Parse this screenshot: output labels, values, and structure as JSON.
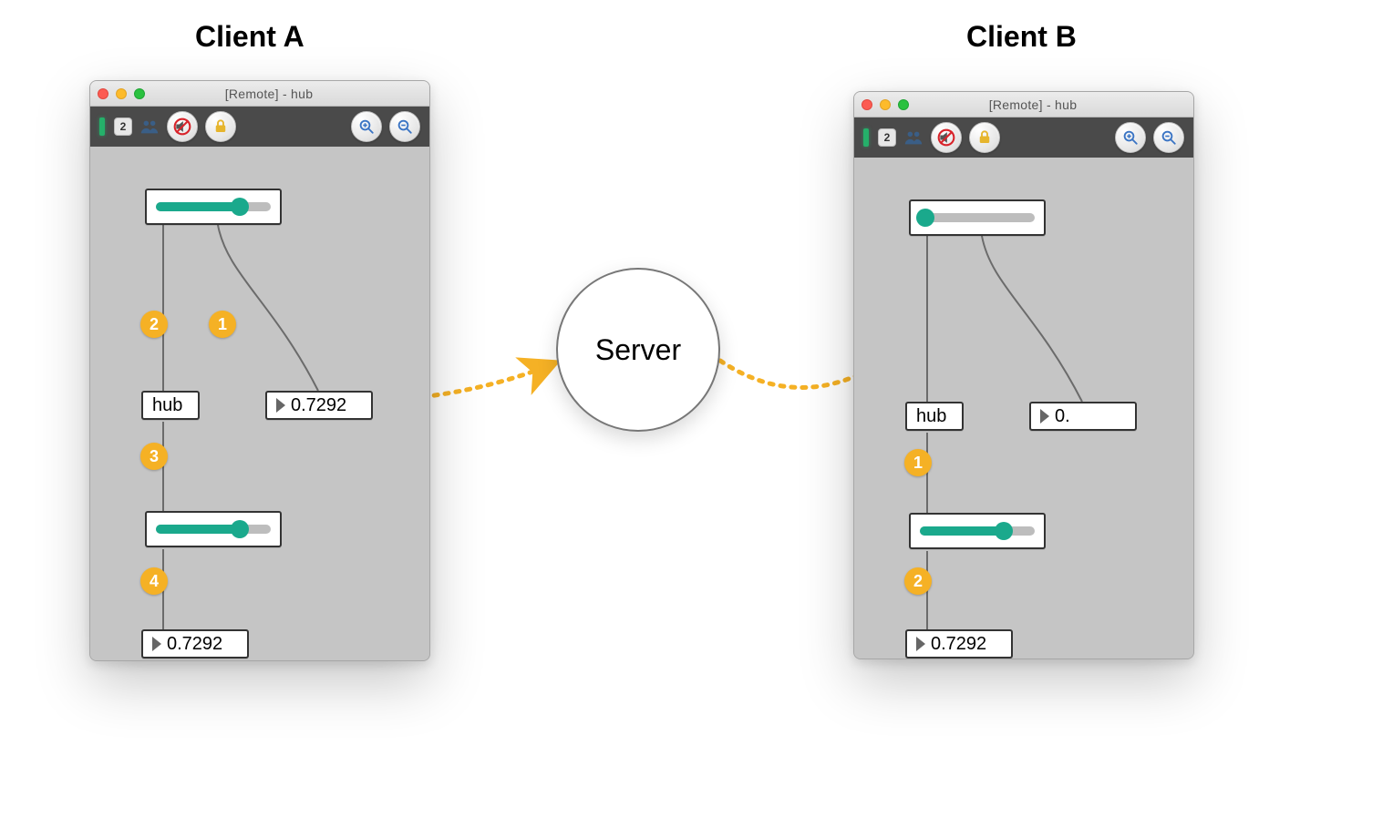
{
  "titles": {
    "clientA": "Client A",
    "clientB": "Client B"
  },
  "server": {
    "label": "Server"
  },
  "windows": {
    "A": {
      "title": "[Remote] - hub",
      "toolbar": {
        "badge": "2"
      },
      "sliderTop": {
        "value": 0.7292
      },
      "sliderBottom": {
        "value": 0.7292
      },
      "numboxInline": "0.7292",
      "hubLabel": "hub",
      "numboxBottom": "0.7292",
      "steps": {
        "s1": "1",
        "s2": "2",
        "s3": "3",
        "s4": "4"
      }
    },
    "B": {
      "title": "[Remote] - hub",
      "toolbar": {
        "badge": "2"
      },
      "sliderTop": {
        "value": 0.05
      },
      "sliderBottom": {
        "value": 0.7292
      },
      "numboxInline": "0.",
      "hubLabel": "hub",
      "numboxBottom": "0.7292",
      "steps": {
        "s1": "1",
        "s2": "2"
      }
    }
  },
  "icons": {
    "close": "close-icon",
    "min": "minimize-icon",
    "max": "maximize-icon",
    "users": "users-icon",
    "mute": "mute-audio-icon",
    "lock": "lock-icon",
    "zoomIn": "zoom-in-icon",
    "zoomOut": "zoom-out-icon"
  },
  "colors": {
    "accent": "#f5b125",
    "teal": "#1aa98c",
    "toolbar": "#4a4a4a",
    "canvas": "#c5c5c5"
  }
}
